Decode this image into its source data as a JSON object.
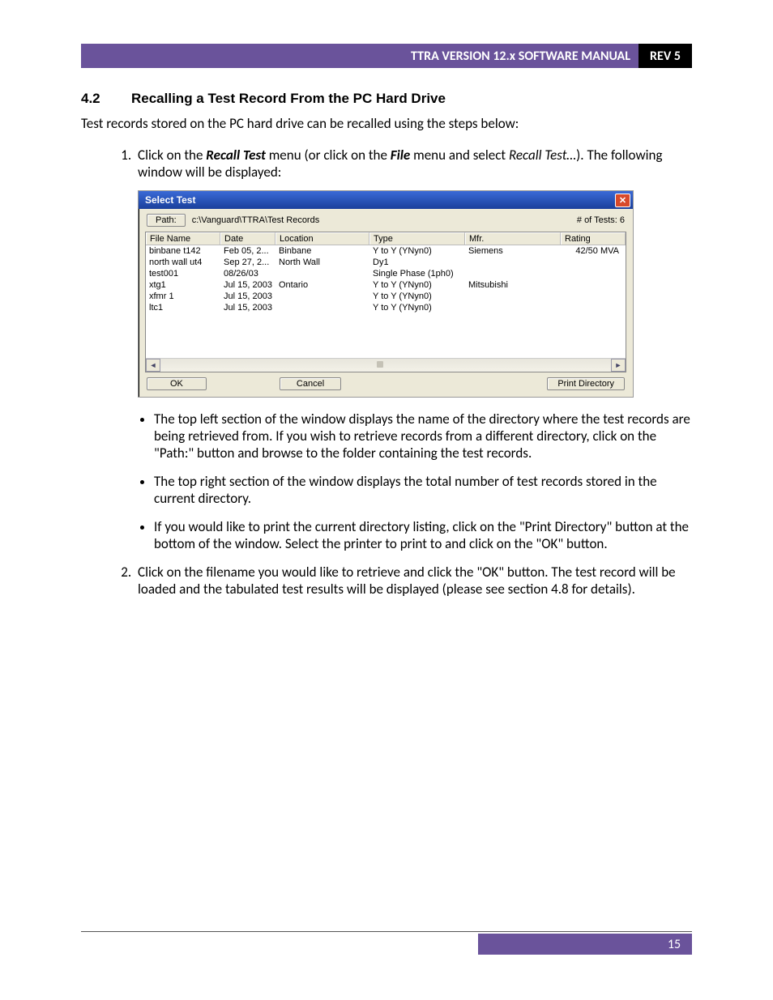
{
  "header": {
    "title": "TTRA VERSION 12.x SOFTWARE MANUAL",
    "rev": "REV 5"
  },
  "section": {
    "number": "4.2",
    "title": "Recalling a Test Record From the PC Hard Drive"
  },
  "intro": "Test records stored on the PC hard drive can be recalled using the steps below:",
  "step1": {
    "pre": "Click on the ",
    "bold1": "Recall Test",
    "mid": " menu (or click on the ",
    "bold2": "File",
    "post1": " menu and select ",
    "italic": "Recall Test…",
    "post2": "). The following window will be displayed:"
  },
  "dialog": {
    "title": "Select Test",
    "path_button": "Path:",
    "path_value": "c:\\Vanguard\\TTRA\\Test Records",
    "tests_label": "# of Tests: 6",
    "columns": {
      "filename": "File Name",
      "date": "Date",
      "location": "Location",
      "type": "Type",
      "mfr": "Mfr.",
      "rating": "Rating"
    },
    "rows": [
      {
        "fn": "binbane t142",
        "dt": "Feb 05, 2...",
        "lc": "Binbane",
        "ty": "Y to Y (YNyn0)",
        "mf": "Siemens",
        "rt": "42/50 MVA"
      },
      {
        "fn": "north wall ut4",
        "dt": "Sep 27, 2...",
        "lc": "North Wall",
        "ty": "Dy1",
        "mf": "",
        "rt": ""
      },
      {
        "fn": "test001",
        "dt": "08/26/03",
        "lc": "",
        "ty": "Single Phase (1ph0)",
        "mf": "",
        "rt": ""
      },
      {
        "fn": "xtg1",
        "dt": "Jul 15, 2003",
        "lc": "Ontario",
        "ty": "Y to Y (YNyn0)",
        "mf": "Mitsubishi",
        "rt": ""
      },
      {
        "fn": "xfmr 1",
        "dt": "Jul 15, 2003",
        "lc": "",
        "ty": "Y to Y (YNyn0)",
        "mf": "",
        "rt": ""
      },
      {
        "fn": "ltc1",
        "dt": "Jul 15, 2003",
        "lc": "",
        "ty": "Y to Y (YNyn0)",
        "mf": "",
        "rt": ""
      }
    ],
    "ok": "OK",
    "cancel": "Cancel",
    "print": "Print Directory"
  },
  "bullets": [
    "The top left section of the window displays the name of the directory where the test records are being retrieved from. If you wish to retrieve records from a different directory, click on the \"Path:\" button and browse to the folder containing the test records.",
    "The top right section of the window displays the total number of test records stored in the current directory.",
    "If you would like to print the current directory listing, click on the \"Print Directory\" button at the bottom of the window. Select the printer to print to and click on the \"OK\" button."
  ],
  "step2": "Click on the filename you would like to retrieve and click the \"OK\" button. The test record will be loaded and the tabulated test results will be displayed (please see section 4.8 for details).",
  "page_number": "15"
}
